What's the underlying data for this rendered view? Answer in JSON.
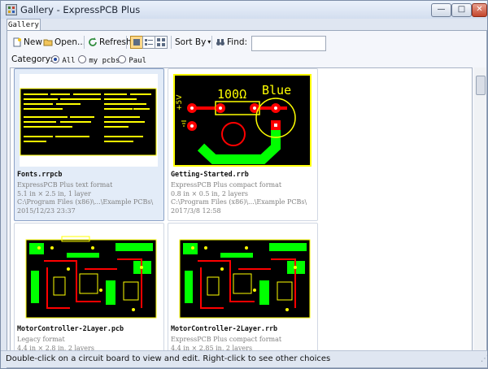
{
  "window": {
    "title": "Gallery - ExpressPCB Plus",
    "buttons": {
      "minimize": "—",
      "maximize": "□",
      "close": "✕"
    }
  },
  "tabs": {
    "gallery": "Gallery"
  },
  "toolbar": {
    "new": "New",
    "open": "Open...",
    "refresh": "Refresh",
    "sort_by": "Sort By",
    "find": "Find:",
    "find_value": ""
  },
  "category": {
    "label": "Category:",
    "options": [
      "All",
      "my pcbs",
      "Paul"
    ]
  },
  "gallery": {
    "cards": [
      {
        "title": "Fonts.rrpcb",
        "format": "ExpressPCB Plus text format",
        "size": "5.1 in × 2.5 in, 1 layer",
        "path": "C:\\Program Files (x86)\\...\\Example PCBs\\",
        "date": "2015/12/23 23:37"
      },
      {
        "title": "Getting-Started.rrb",
        "format": "ExpressPCB Plus compact format",
        "size": "0.8 in × 0.5 in, 2 layers",
        "path": "C:\\Program Files (x86)\\...\\Example PCBs\\",
        "date": "2017/3/8 12:58",
        "thumb": {
          "resistor": "100Ω",
          "led": "Blue",
          "voltage": "+5V"
        }
      },
      {
        "title": "MotorController-2Layer.pcb",
        "format": "Legacy format",
        "size": "4.4 in × 2.8 in, 2 layers"
      },
      {
        "title": "MotorController-2Layer.rrb",
        "format": "ExpressPCB Plus compact format",
        "size": "4.4 in × 2.85 in, 2 layers"
      }
    ]
  },
  "status": {
    "message": "Double-click on a circuit board to view and edit. Right-click to see other choices"
  },
  "colors": {
    "board": "#000000",
    "trace": "#ffff00",
    "pad": "#ff0000",
    "silk_green": "#00ff00",
    "selected_card": "#e3ecf8"
  }
}
